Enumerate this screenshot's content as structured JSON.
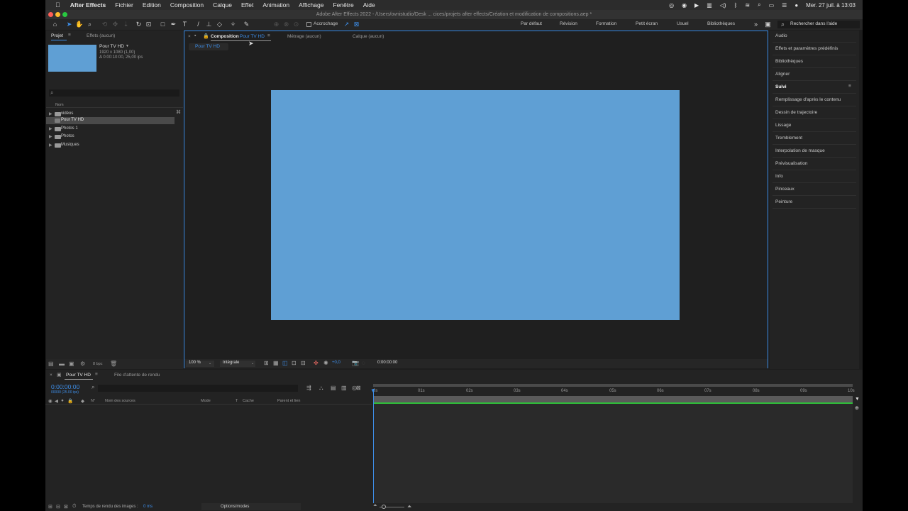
{
  "menubar": {
    "app_name": "After Effects",
    "items": [
      "Fichier",
      "Edition",
      "Composition",
      "Calque",
      "Effet",
      "Animation",
      "Affichage",
      "Fenêtre",
      "Aide"
    ],
    "datetime": "Mer. 27 juil. à 13:03"
  },
  "window": {
    "title": "Adobe After Effects 2022 - /Users/ovnistudio/Desk ... cices/projets after effects/Création et modification de compositions.aep *"
  },
  "toolbar": {
    "snap_label": "Accrochage",
    "workspaces": [
      "Par défaut",
      "Révision",
      "Formation",
      "Petit écran",
      "Usuel",
      "Bibliothèques"
    ],
    "search_label": "Rechercher dans l'aide"
  },
  "project": {
    "tab_project": "Projet",
    "tab_effects": "Effets (aucun)",
    "comp_name": "Pour TV HD",
    "comp_dims": "1920 x 1080 (1,00)",
    "comp_duration": "Δ 0:00:10:00, 25,00 ips",
    "column_name": "Nom",
    "items": [
      {
        "name": "vidéos",
        "type": "folder"
      },
      {
        "name": "Pour TV HD",
        "type": "comp"
      },
      {
        "name": "Photos 1",
        "type": "folder"
      },
      {
        "name": "Photos",
        "type": "folder"
      },
      {
        "name": "Musiques",
        "type": "folder"
      }
    ],
    "bpc": "8 bpc"
  },
  "viewer": {
    "tab_comp_prefix": "Composition",
    "tab_comp_name": "Pour TV HD",
    "tab_footage": "Métrage (aucun)",
    "tab_layer": "Calque (aucun)",
    "breadcrumb": "Pour TV HD",
    "zoom": "100 %",
    "resolution": "Intégrale",
    "exposure": "+0,0",
    "timecode": "0:00:00:00",
    "canvas_color": "#5f9fd4"
  },
  "right_panels": [
    "Audio",
    "Effets et paramètres prédéfinis",
    "Bibliothèques",
    "Aligner",
    "Suivi",
    "Remplissage d'après le contenu",
    "Dessin de trajectoire",
    "Lissage",
    "Tremblement",
    "Interpolation de masque",
    "Prévisualisation",
    "Info",
    "Pinceaux",
    "Peinture"
  ],
  "timeline": {
    "tab_comp": "Pour TV HD",
    "tab_render": "File d'attente de rendu",
    "timecode": "0:00:00:00",
    "timecode_sub": "00000 (25.00 ips)",
    "columns": [
      "N°",
      "Nom des sources",
      "Mode",
      "T",
      "Cache",
      "Parent et lien"
    ],
    "ruler": [
      "0s",
      "01s",
      "02s",
      "03s",
      "04s",
      "05s",
      "06s",
      "07s",
      "08s",
      "09s",
      "10s"
    ],
    "render_time_label": "Temps de rendu des images :",
    "render_time_value": "0 ms",
    "options_label": "Options/modes"
  }
}
